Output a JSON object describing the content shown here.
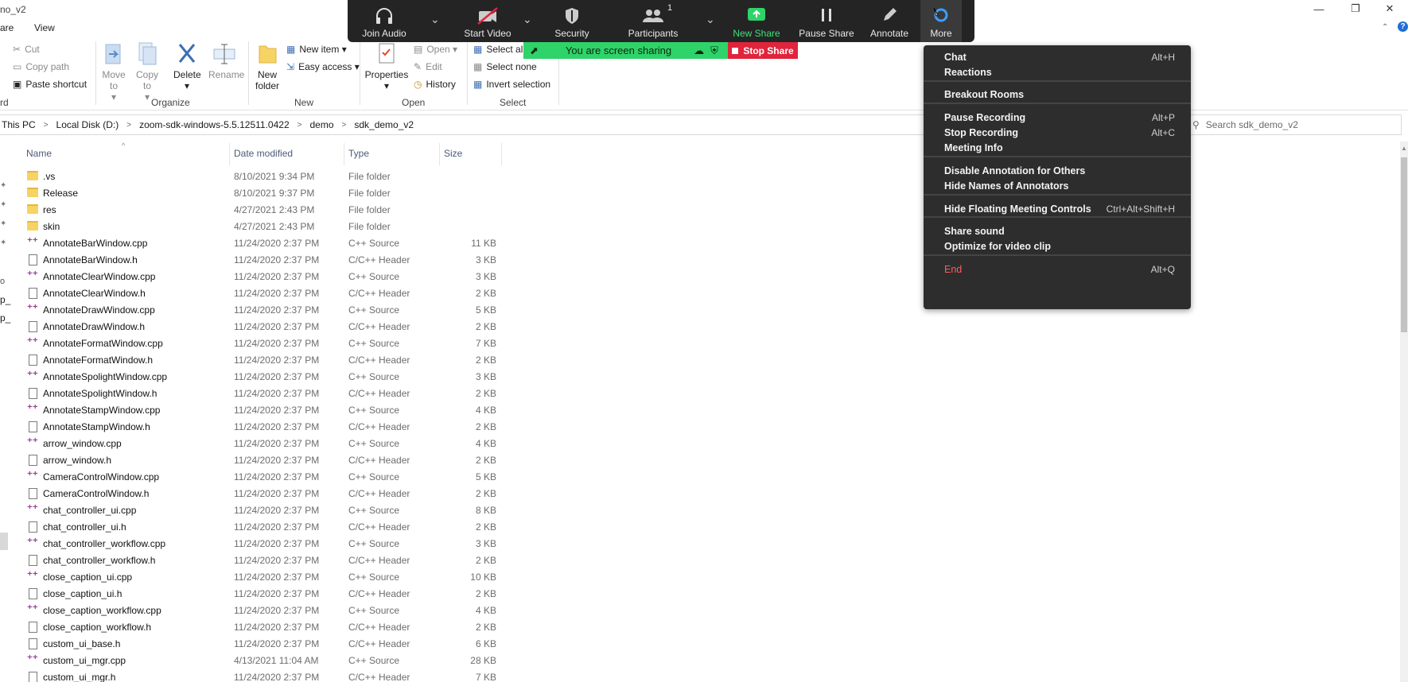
{
  "window": {
    "title": "no_v2",
    "minimize_icon": "—",
    "maximize_icon": "❐",
    "close_icon": "✕"
  },
  "menu_tabs": [
    "are",
    "View"
  ],
  "ribbon": {
    "clipboard": {
      "cut": "Cut",
      "copy_path": "Copy path",
      "paste_shortcut": "Paste shortcut",
      "group": "rd"
    },
    "organize": {
      "move_to": "Move to",
      "copy_to": "Copy to",
      "delete": "Delete",
      "rename": "Rename",
      "group": "Organize"
    },
    "new": {
      "new_folder": "New folder",
      "new_item": "New item ▾",
      "easy_access": "Easy access ▾",
      "group": "New"
    },
    "open": {
      "properties": "Properties",
      "open": "Open ▾",
      "edit": "Edit",
      "history": "History",
      "group": "Open"
    },
    "select": {
      "select_all": "Select all",
      "select_none": "Select none",
      "invert_selection": "Invert selection",
      "group": "Select"
    }
  },
  "address": {
    "crumbs": [
      "This PC",
      "Local Disk (D:)",
      "zoom-sdk-windows-5.5.12511.0422",
      "demo",
      "sdk_demo_v2"
    ],
    "separator": ">",
    "search_placeholder": "Search sdk_demo_v2"
  },
  "columns": {
    "name": "Name",
    "date": "Date modified",
    "type": "Type",
    "size": "Size"
  },
  "files": [
    {
      "name": ".vs",
      "date": "8/10/2021 9:34 PM",
      "type": "File folder",
      "size": "",
      "kind": "folder"
    },
    {
      "name": "Release",
      "date": "8/10/2021 9:37 PM",
      "type": "File folder",
      "size": "",
      "kind": "folder"
    },
    {
      "name": "res",
      "date": "4/27/2021 2:43 PM",
      "type": "File folder",
      "size": "",
      "kind": "folder"
    },
    {
      "name": "skin",
      "date": "4/27/2021 2:43 PM",
      "type": "File folder",
      "size": "",
      "kind": "folder"
    },
    {
      "name": "AnnotateBarWindow.cpp",
      "date": "11/24/2020 2:37 PM",
      "type": "C++ Source",
      "size": "11 KB",
      "kind": "cpp"
    },
    {
      "name": "AnnotateBarWindow.h",
      "date": "11/24/2020 2:37 PM",
      "type": "C/C++ Header",
      "size": "3 KB",
      "kind": "h"
    },
    {
      "name": "AnnotateClearWindow.cpp",
      "date": "11/24/2020 2:37 PM",
      "type": "C++ Source",
      "size": "3 KB",
      "kind": "cpp"
    },
    {
      "name": "AnnotateClearWindow.h",
      "date": "11/24/2020 2:37 PM",
      "type": "C/C++ Header",
      "size": "2 KB",
      "kind": "h"
    },
    {
      "name": "AnnotateDrawWindow.cpp",
      "date": "11/24/2020 2:37 PM",
      "type": "C++ Source",
      "size": "5 KB",
      "kind": "cpp"
    },
    {
      "name": "AnnotateDrawWindow.h",
      "date": "11/24/2020 2:37 PM",
      "type": "C/C++ Header",
      "size": "2 KB",
      "kind": "h"
    },
    {
      "name": "AnnotateFormatWindow.cpp",
      "date": "11/24/2020 2:37 PM",
      "type": "C++ Source",
      "size": "7 KB",
      "kind": "cpp"
    },
    {
      "name": "AnnotateFormatWindow.h",
      "date": "11/24/2020 2:37 PM",
      "type": "C/C++ Header",
      "size": "2 KB",
      "kind": "h"
    },
    {
      "name": "AnnotateSpolightWindow.cpp",
      "date": "11/24/2020 2:37 PM",
      "type": "C++ Source",
      "size": "3 KB",
      "kind": "cpp"
    },
    {
      "name": "AnnotateSpolightWindow.h",
      "date": "11/24/2020 2:37 PM",
      "type": "C/C++ Header",
      "size": "2 KB",
      "kind": "h"
    },
    {
      "name": "AnnotateStampWindow.cpp",
      "date": "11/24/2020 2:37 PM",
      "type": "C++ Source",
      "size": "4 KB",
      "kind": "cpp"
    },
    {
      "name": "AnnotateStampWindow.h",
      "date": "11/24/2020 2:37 PM",
      "type": "C/C++ Header",
      "size": "2 KB",
      "kind": "h"
    },
    {
      "name": "arrow_window.cpp",
      "date": "11/24/2020 2:37 PM",
      "type": "C++ Source",
      "size": "4 KB",
      "kind": "cpp"
    },
    {
      "name": "arrow_window.h",
      "date": "11/24/2020 2:37 PM",
      "type": "C/C++ Header",
      "size": "2 KB",
      "kind": "h"
    },
    {
      "name": "CameraControlWindow.cpp",
      "date": "11/24/2020 2:37 PM",
      "type": "C++ Source",
      "size": "5 KB",
      "kind": "cpp"
    },
    {
      "name": "CameraControlWindow.h",
      "date": "11/24/2020 2:37 PM",
      "type": "C/C++ Header",
      "size": "2 KB",
      "kind": "h"
    },
    {
      "name": "chat_controller_ui.cpp",
      "date": "11/24/2020 2:37 PM",
      "type": "C++ Source",
      "size": "8 KB",
      "kind": "cpp"
    },
    {
      "name": "chat_controller_ui.h",
      "date": "11/24/2020 2:37 PM",
      "type": "C/C++ Header",
      "size": "2 KB",
      "kind": "h"
    },
    {
      "name": "chat_controller_workflow.cpp",
      "date": "11/24/2020 2:37 PM",
      "type": "C++ Source",
      "size": "3 KB",
      "kind": "cpp"
    },
    {
      "name": "chat_controller_workflow.h",
      "date": "11/24/2020 2:37 PM",
      "type": "C/C++ Header",
      "size": "2 KB",
      "kind": "h"
    },
    {
      "name": "close_caption_ui.cpp",
      "date": "11/24/2020 2:37 PM",
      "type": "C++ Source",
      "size": "10 KB",
      "kind": "cpp"
    },
    {
      "name": "close_caption_ui.h",
      "date": "11/24/2020 2:37 PM",
      "type": "C/C++ Header",
      "size": "2 KB",
      "kind": "h"
    },
    {
      "name": "close_caption_workflow.cpp",
      "date": "11/24/2020 2:37 PM",
      "type": "C++ Source",
      "size": "4 KB",
      "kind": "cpp"
    },
    {
      "name": "close_caption_workflow.h",
      "date": "11/24/2020 2:37 PM",
      "type": "C/C++ Header",
      "size": "2 KB",
      "kind": "h"
    },
    {
      "name": "custom_ui_base.h",
      "date": "11/24/2020 2:37 PM",
      "type": "C/C++ Header",
      "size": "6 KB",
      "kind": "h"
    },
    {
      "name": "custom_ui_mgr.cpp",
      "date": "4/13/2021 11:04 AM",
      "type": "C++ Source",
      "size": "28 KB",
      "kind": "cpp"
    },
    {
      "name": "custom_ui_mgr.h",
      "date": "11/24/2020 2:37 PM",
      "type": "C/C++ Header",
      "size": "7 KB",
      "kind": "h"
    }
  ],
  "zoom_toolbar": {
    "join_audio": "Join Audio",
    "start_video": "Start Video",
    "security": "Security",
    "participants": "Participants",
    "participants_count": "1",
    "new_share": "New Share",
    "pause_share": "Pause Share",
    "annotate": "Annotate",
    "more": "More",
    "sharing_text": "You are screen sharing",
    "stop_share": "Stop Share",
    "accent_green": "#2ed36a",
    "stop_red": "#e0243b"
  },
  "more_menu": [
    {
      "label": "Chat",
      "shortcut": "Alt+H"
    },
    {
      "label": "Reactions",
      "shortcut": ""
    },
    {
      "label": "Breakout Rooms",
      "shortcut": ""
    },
    {
      "label": "Pause Recording",
      "shortcut": "Alt+P"
    },
    {
      "label": "Stop Recording",
      "shortcut": "Alt+C"
    },
    {
      "label": "Meeting Info",
      "shortcut": ""
    },
    {
      "label": "Disable Annotation for Others",
      "shortcut": ""
    },
    {
      "label": "Hide Names of Annotators",
      "shortcut": ""
    },
    {
      "label": "Hide Floating Meeting Controls",
      "shortcut": "Ctrl+Alt+Shift+H"
    },
    {
      "label": "Share sound",
      "shortcut": ""
    },
    {
      "label": "Optimize for video clip",
      "shortcut": ""
    },
    {
      "label": "End",
      "shortcut": "Alt+Q"
    }
  ],
  "side_pins": [
    "p_",
    "p_"
  ]
}
